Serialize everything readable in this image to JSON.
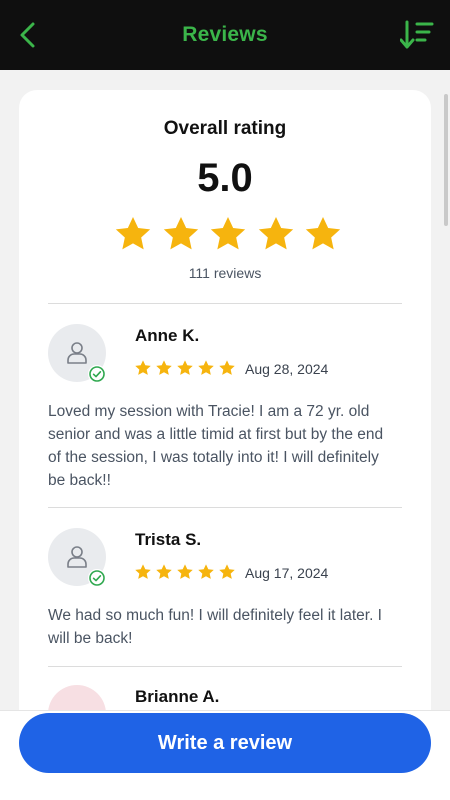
{
  "header": {
    "title": "Reviews",
    "back_icon": "chevron-left-icon",
    "sort_icon": "sort-descending-icon",
    "accent_color": "#3bb54a"
  },
  "overall": {
    "label": "Overall rating",
    "score": "5.0",
    "stars": 5,
    "reviews_count": "111 reviews",
    "star_color": "#f6b40e"
  },
  "reviews": [
    {
      "name": "Anne K.",
      "stars": 5,
      "date": "Aug 28, 2024",
      "text": "Loved my session with Tracie! I am a 72 yr. old senior and was a little timid at first but by the end of the session, I was totally into it! I will definitely be back!!"
    },
    {
      "name": "Trista S.",
      "stars": 5,
      "date": "Aug 17, 2024",
      "text": "We had so much fun! I will definitely feel it later. I will be back!"
    },
    {
      "name": "Brianne A."
    }
  ],
  "footer": {
    "write_review_label": "Write a review",
    "button_color": "#1f63e6"
  }
}
